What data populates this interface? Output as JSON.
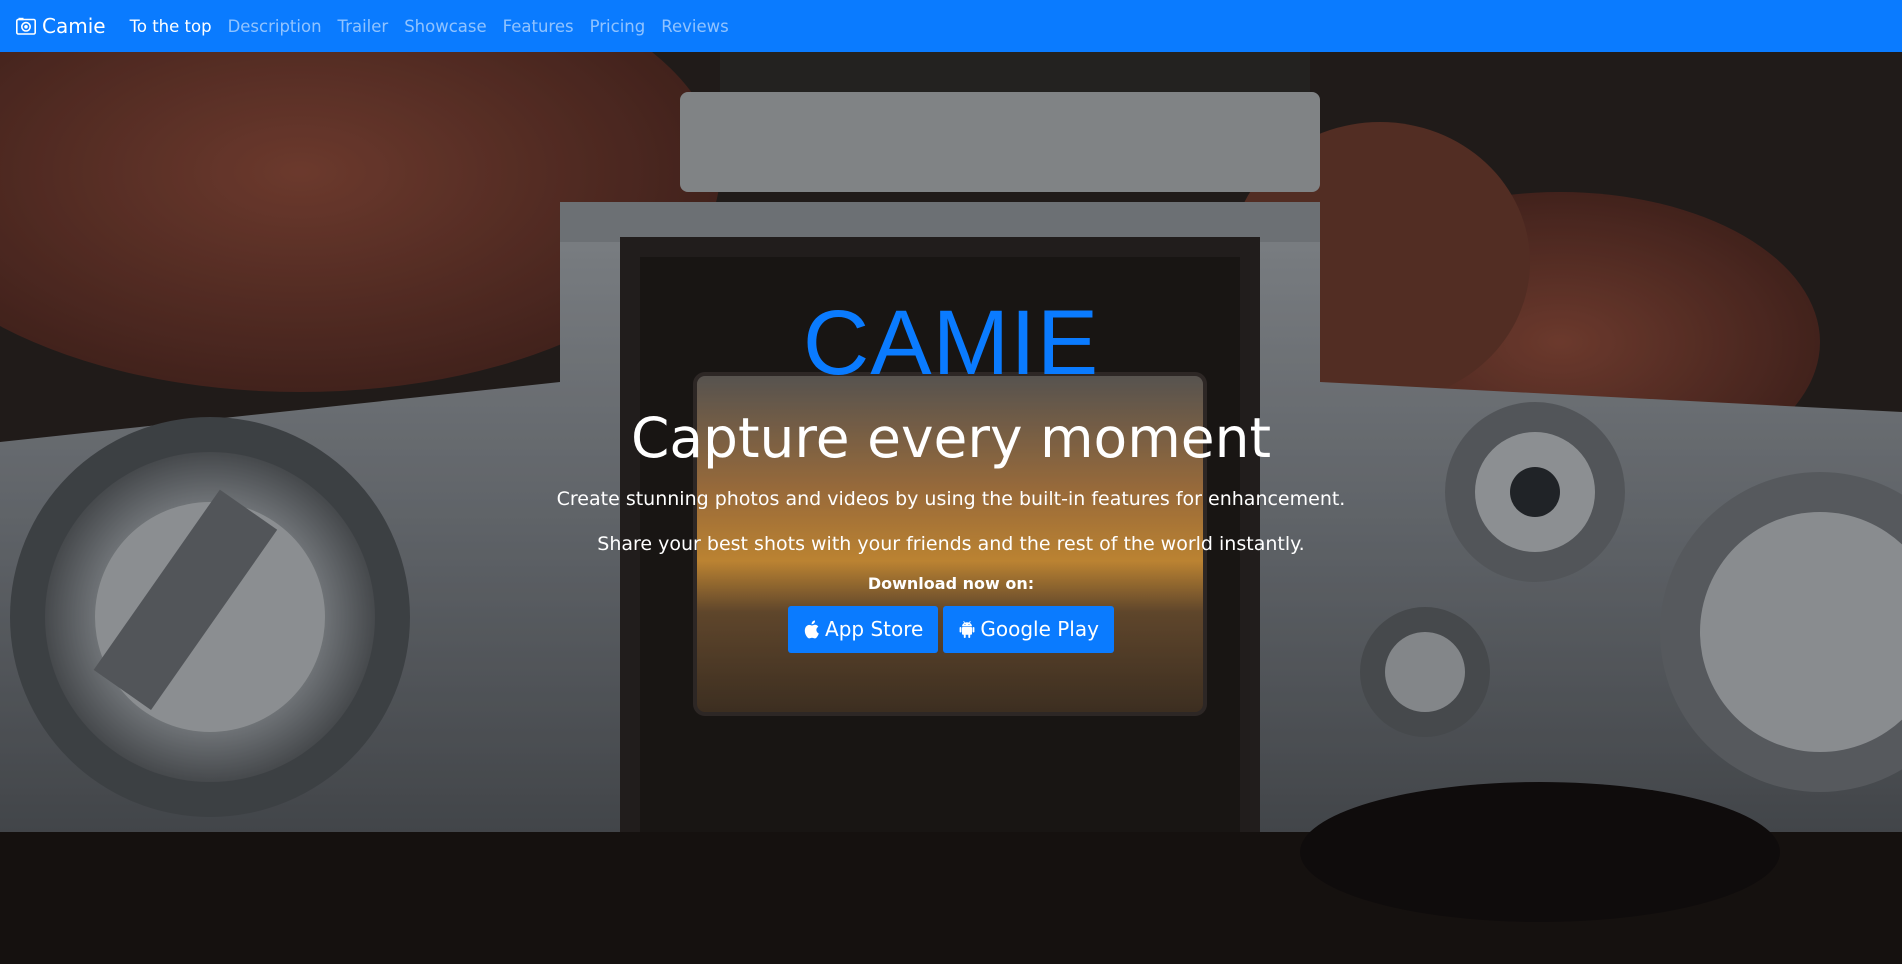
{
  "navbar": {
    "brand_label": "Camie",
    "brand_icon": "camera-icon",
    "links": [
      {
        "label": "To the top",
        "active": true
      },
      {
        "label": "Description",
        "active": false
      },
      {
        "label": "Trailer",
        "active": false
      },
      {
        "label": "Showcase",
        "active": false
      },
      {
        "label": "Features",
        "active": false
      },
      {
        "label": "Pricing",
        "active": false
      },
      {
        "label": "Reviews",
        "active": false
      }
    ]
  },
  "hero": {
    "title": "CAMIE",
    "subtitle": "Capture every moment",
    "description_1": "Create stunning photos and videos by using the built-in features for enhancement.",
    "description_2": "Share your best shots with your friends and the rest of the world instantly.",
    "download_label": "Download now on:",
    "buttons": [
      {
        "label": "App Store",
        "icon": "apple-icon"
      },
      {
        "label": "Google Play",
        "icon": "android-icon"
      }
    ]
  },
  "colors": {
    "primary": "#0a7bff",
    "nav_inactive": "rgba(255,255,255,0.55)",
    "text_light": "#ffffff"
  }
}
